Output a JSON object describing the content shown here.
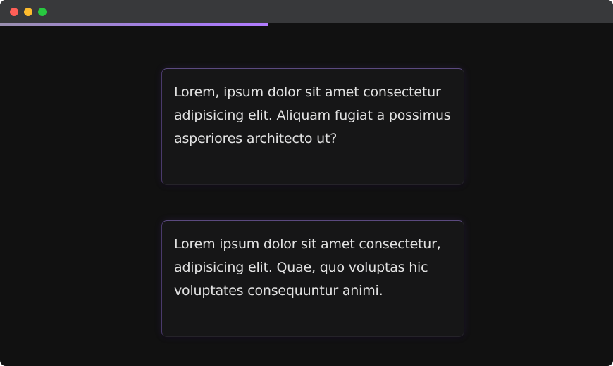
{
  "window": {
    "controls": {
      "close_color": "#ff5f57",
      "minimize_color": "#febc2e",
      "maximize_color": "#28c840"
    }
  },
  "progress": {
    "fraction": 0.438,
    "color": "#a57cf0"
  },
  "cards": [
    {
      "text": "Lorem, ipsum dolor sit amet consectetur adipisicing elit. Aliquam fugiat a possimus asperiores architecto ut?"
    },
    {
      "text": "Lorem ipsum dolor sit amet consectetur, adipisicing elit. Quae, quo voluptas hic voluptates consequuntur animi."
    }
  ],
  "colors": {
    "background": "#111111",
    "card_background": "#161617",
    "card_accent": "#5b4a7f",
    "text": "#e3e3e3"
  }
}
